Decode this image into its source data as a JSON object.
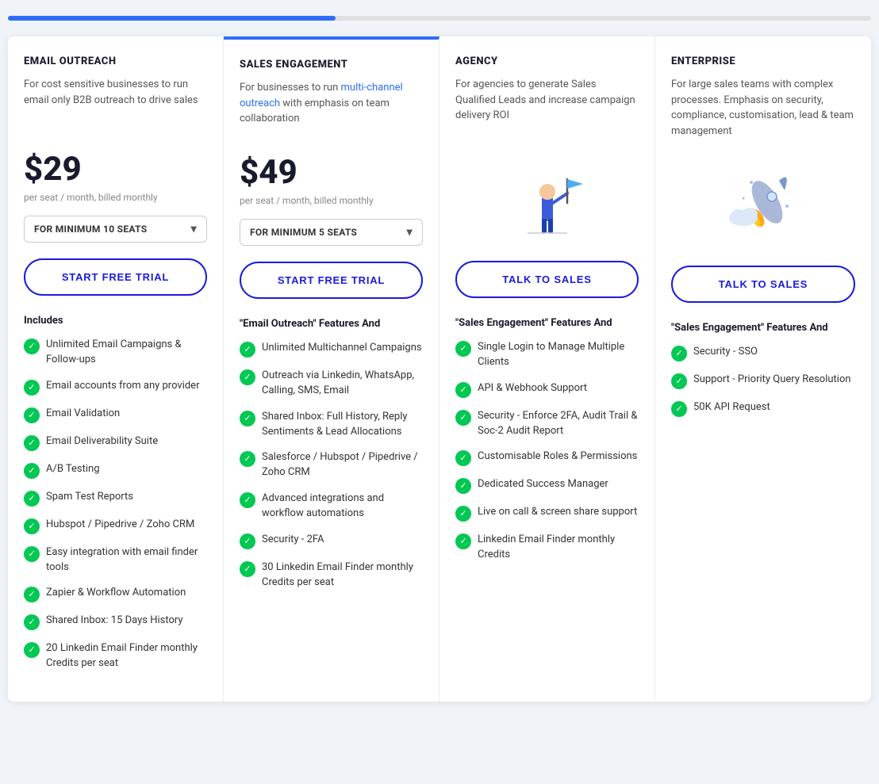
{
  "topbar": {
    "active_label": "active portion"
  },
  "plans": [
    {
      "id": "email-outreach",
      "name": "EMAIL OUTREACH",
      "desc": "For cost sensitive businesses to run email only B2B outreach to drive sales",
      "price": "$29",
      "price_sub": "per seat / month, billed monthly",
      "seats_label": "FOR MINIMUM 10 SEATS",
      "cta_label": "START FREE TRIAL",
      "features_heading": "Includes",
      "features": [
        "Unlimited Email Campaigns & Follow-ups",
        "Email accounts from any provider",
        "Email Validation",
        "Email Deliverability Suite",
        "A/B Testing",
        "Spam Test Reports",
        "Hubspot / Pipedrive / Zoho CRM",
        "Easy integration with email finder tools",
        "Zapier & Workflow Automation",
        "Shared Inbox: 15 Days History",
        "20 Linkedin Email Finder monthly Credits per seat"
      ],
      "has_illustration": false,
      "has_price": true,
      "highlighted": false
    },
    {
      "id": "sales-engagement",
      "name": "SALES ENGAGEMENT",
      "desc_parts": [
        "For businesses to run ",
        "multi-channel outreach",
        " with emphasis on team collaboration"
      ],
      "desc_link": "multi-channel outreach",
      "price": "$49",
      "price_sub": "per seat / month, billed monthly",
      "seats_label": "FOR MINIMUM 5 SEATS",
      "cta_label": "START FREE TRIAL",
      "features_heading": "\"Email Outreach\" Features And",
      "features": [
        "Unlimited Multichannel Campaigns",
        "Outreach via Linkedin, WhatsApp, Calling, SMS, Email",
        "Shared Inbox: Full History, Reply Sentiments & Lead Allocations",
        "Salesforce / Hubspot / Pipedrive / Zoho CRM",
        "Advanced integrations and workflow automations",
        "Security - 2FA",
        "30 Linkedin Email Finder monthly Credits per seat"
      ],
      "has_illustration": false,
      "has_price": true,
      "highlighted": true
    },
    {
      "id": "agency",
      "name": "AGENCY",
      "desc": "For agencies to generate Sales Qualified Leads and increase campaign delivery ROI",
      "price": null,
      "price_sub": null,
      "seats_label": null,
      "cta_label": "TALK TO SALES",
      "features_heading": "\"Sales Engagement\" Features And",
      "features": [
        "Single Login to Manage Multiple Clients",
        "API & Webhook Support",
        "Security - Enforce 2FA, Audit Trail & Soc-2 Audit Report",
        "Customisable Roles & Permissions",
        "Dedicated Success Manager",
        "Live on call & screen share support",
        "Linkedin Email Finder monthly Credits"
      ],
      "has_illustration": true,
      "illustration_type": "agency",
      "has_price": false,
      "highlighted": false
    },
    {
      "id": "enterprise",
      "name": "ENTERPRISE",
      "desc": "For large sales teams with complex processes. Emphasis on security, compliance, customisation, lead & team management",
      "price": null,
      "price_sub": null,
      "seats_label": null,
      "cta_label": "TALK TO SALES",
      "features_heading": "\"Sales Engagement\" Features And",
      "features": [
        "Security - SSO",
        "Support - Priority Query Resolution",
        "50K API Request"
      ],
      "has_illustration": true,
      "illustration_type": "enterprise",
      "has_price": false,
      "highlighted": false
    }
  ],
  "icons": {
    "check": "✓",
    "chevron_down": "▾"
  }
}
